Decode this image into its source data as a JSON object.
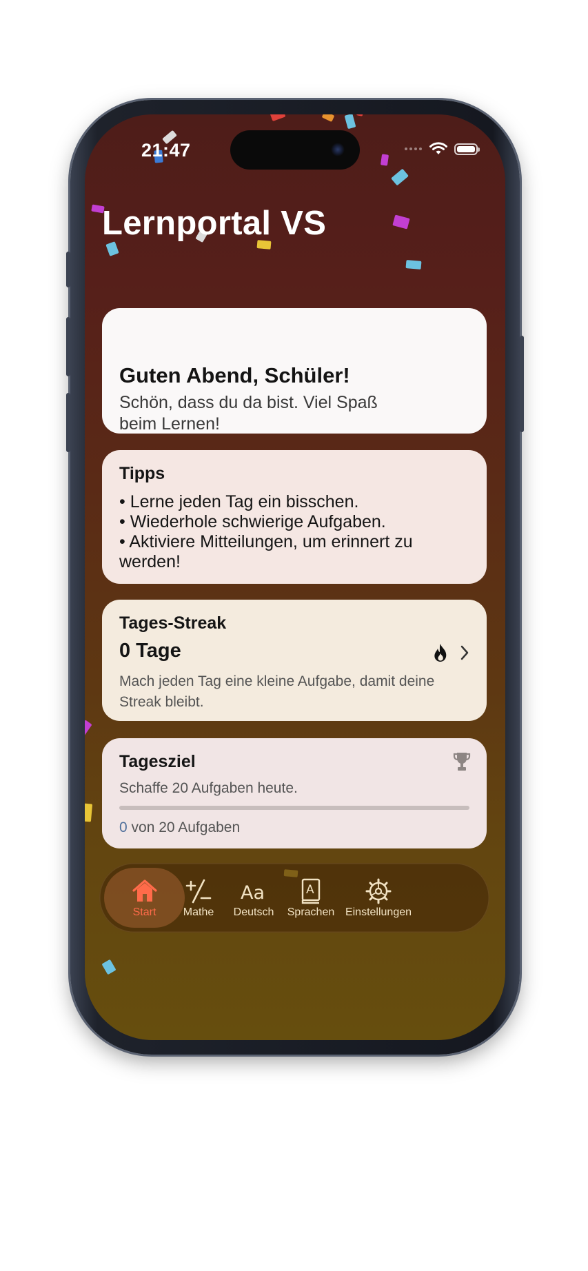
{
  "status_bar": {
    "time": "21:47"
  },
  "app_title": "Lernportal VS",
  "greeting": {
    "title": "Guten Abend, Schüler!",
    "subtitle": "Schön, dass du da bist. Viel Spaß beim Lernen!"
  },
  "tips": {
    "title": "Tipps",
    "items": [
      "• Lerne jeden Tag ein bisschen.",
      "• Wiederhole schwierige Aufgaben.",
      "• Aktiviere Mitteilungen, um erinnert zu werden!"
    ]
  },
  "streak": {
    "title": "Tages-Streak",
    "value": "0 Tage",
    "description": "Mach jeden Tag eine kleine Aufgabe, damit deine Streak bleibt.",
    "icons": [
      "flame-icon",
      "chevron-right-icon"
    ]
  },
  "daily_goal": {
    "title": "Tagesziel",
    "description": "Schaffe 20 Aufgaben heute.",
    "done": "0",
    "count_suffix": " von 20 Aufgaben",
    "progress_fraction": 0,
    "icon": "trophy-icon"
  },
  "tab_bar": {
    "active": "Start",
    "tabs": [
      {
        "label": "Start",
        "icon": "house-icon"
      },
      {
        "label": "Mathe",
        "icon": "plus-minus-icon"
      },
      {
        "label": "Deutsch",
        "icon": "text-aa-icon"
      },
      {
        "label": "Sprachen",
        "icon": "book-icon"
      },
      {
        "label": "Einstellungen",
        "icon": "gear-icon"
      }
    ]
  },
  "colors": {
    "background_top": "#4e1d19",
    "background_bottom": "#664e0e",
    "tab_active": "#ff6b4a",
    "progress_accent": "#5d7ea8"
  }
}
